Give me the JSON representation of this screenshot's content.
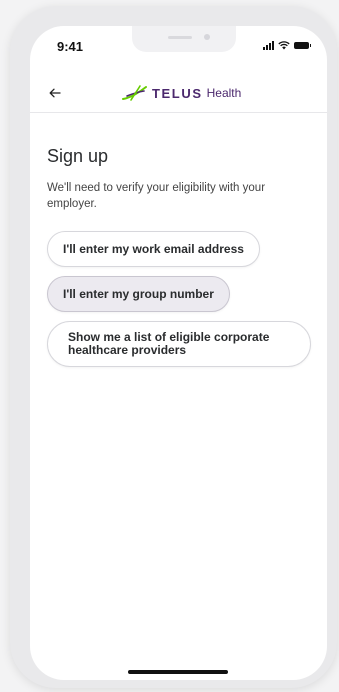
{
  "status_bar": {
    "time": "9:41"
  },
  "header": {
    "back_icon": "arrow-left-icon",
    "logo_brand": "TELUS",
    "logo_product": "Health"
  },
  "main": {
    "title": "Sign up",
    "subtitle": "We'll need to verify your eligibility with your employer.",
    "options": [
      {
        "label": "I'll enter my work email address",
        "selected": false
      },
      {
        "label": "I'll enter my group number",
        "selected": true
      },
      {
        "label": "Show me a list of eligible corporate healthcare providers",
        "selected": false
      }
    ]
  },
  "colors": {
    "brand_purple": "#4b286d",
    "brand_green": "#66cc00",
    "selected_option_bg": "#eceaf0"
  }
}
